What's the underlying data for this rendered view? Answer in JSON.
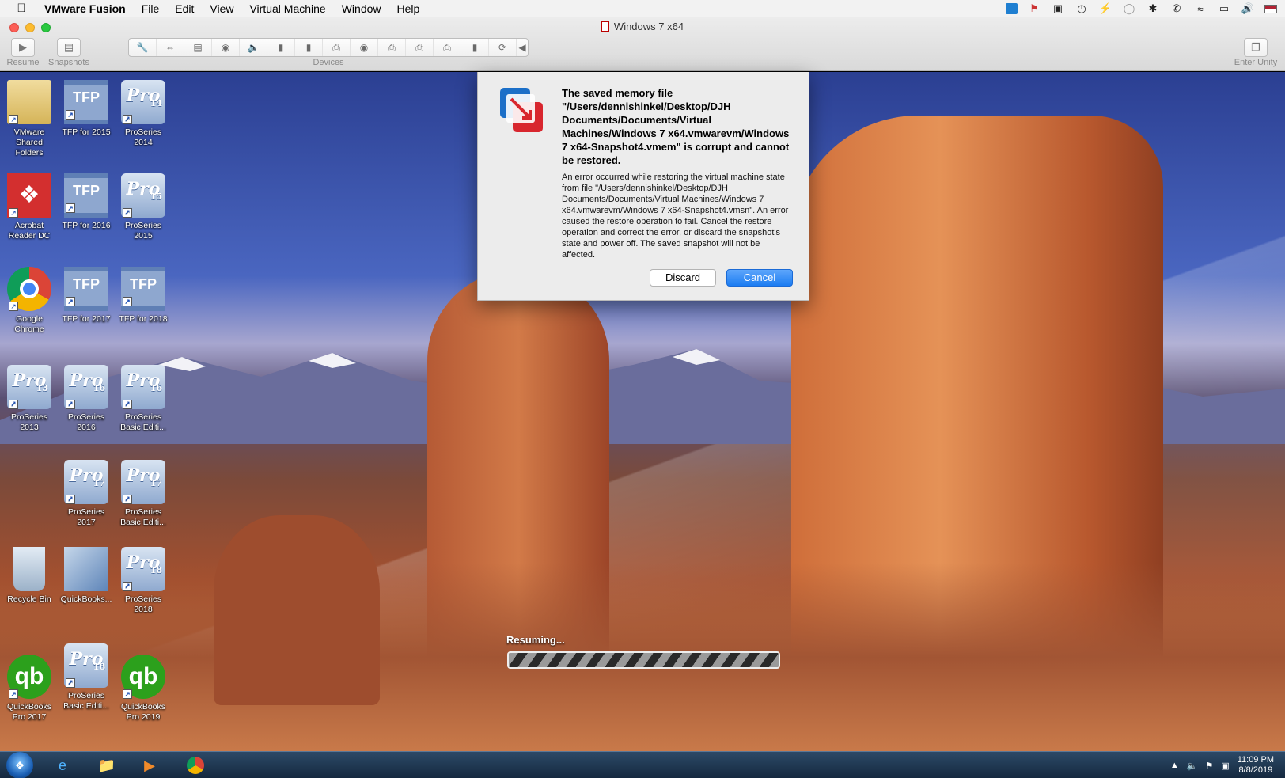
{
  "menubar": {
    "app_name": "VMware Fusion",
    "items": [
      "File",
      "Edit",
      "View",
      "Virtual Machine",
      "Window",
      "Help"
    ]
  },
  "window": {
    "title": "Windows 7 x64",
    "toolbar": {
      "resume_label": "Resume",
      "snapshots_label": "Snapshots",
      "devices_label": "Devices",
      "enter_unity_label": "Enter Unity"
    }
  },
  "desktop": {
    "icons": [
      {
        "label": "VMware Shared Folders",
        "icon": "folder-icon"
      },
      {
        "label": "TFP for 2015",
        "icon": "tfp-icon"
      },
      {
        "label": "ProSeries 2014",
        "icon": "proseries-icon",
        "version": "14"
      },
      {
        "label": "Acrobat Reader DC",
        "icon": "acrobat-icon"
      },
      {
        "label": "TFP for 2016",
        "icon": "tfp-icon"
      },
      {
        "label": "ProSeries 2015",
        "icon": "proseries-icon",
        "version": "15"
      },
      {
        "label": "Google Chrome",
        "icon": "chrome-icon"
      },
      {
        "label": "TFP for 2017",
        "icon": "tfp-icon"
      },
      {
        "label": "TFP for 2018",
        "icon": "tfp-icon"
      },
      {
        "label": "ProSeries 2013",
        "icon": "proseries-icon",
        "version": "13"
      },
      {
        "label": "ProSeries 2016",
        "icon": "proseries-icon",
        "version": "16"
      },
      {
        "label": "ProSeries Basic Editi...",
        "icon": "proseries-icon",
        "version": "16"
      },
      {
        "label": "ProSeries 2017",
        "icon": "proseries-icon",
        "version": "17"
      },
      {
        "label": "ProSeries Basic Editi...",
        "icon": "proseries-icon",
        "version": "17"
      },
      {
        "label": "Recycle Bin",
        "icon": "recycle-bin-icon"
      },
      {
        "label": "QuickBooks...",
        "icon": "quickbooks-installer-icon"
      },
      {
        "label": "ProSeries 2018",
        "icon": "proseries-icon",
        "version": "18"
      },
      {
        "label": "QuickBooks Pro 2017",
        "icon": "quickbooks-icon"
      },
      {
        "label": "ProSeries Basic Editi...",
        "icon": "proseries-icon",
        "version": "18"
      },
      {
        "label": "QuickBooks Pro 2019",
        "icon": "quickbooks-icon"
      }
    ],
    "pro_text": "Pro",
    "tfp_text": "TFP",
    "qb_text": "qb"
  },
  "dialog": {
    "title": "The saved memory file \"/Users/dennishinkel/Desktop/DJH Documents/Documents/Virtual Machines/Windows 7 x64.vmwarevm/Windows 7 x64-Snapshot4.vmem\" is corrupt and cannot be restored.",
    "body": "An error occurred while restoring the virtual machine state from file \"/Users/dennishinkel/Desktop/DJH Documents/Documents/Virtual Machines/Windows 7 x64.vmwarevm/Windows 7 x64-Snapshot4.vmsn\". An error caused the restore operation to fail. Cancel the restore operation and correct the error, or discard the snapshot's state and power off.  The saved snapshot will not be affected.",
    "discard_label": "Discard",
    "cancel_label": "Cancel"
  },
  "resume": {
    "label": "Resuming...",
    "progress": 1.0
  },
  "taskbar": {
    "time": "11:09 PM",
    "date": "8/8/2019"
  },
  "colors": {
    "accent_button": "#1b7cf2",
    "quickbooks_green": "#2ca01c",
    "taskbar": "#1c3550"
  }
}
